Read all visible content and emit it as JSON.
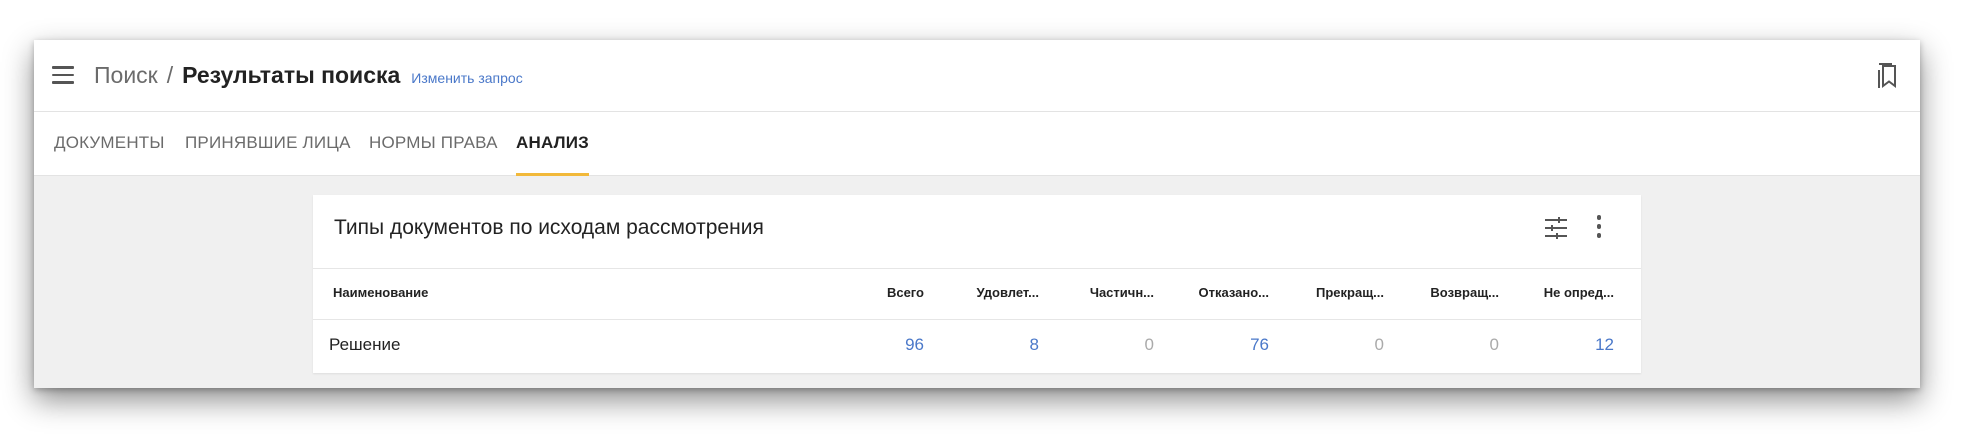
{
  "header": {
    "breadcrumb_root": "Поиск",
    "breadcrumb_separator": "/",
    "breadcrumb_current": "Результаты поиска",
    "edit_query_link": "Изменить запрос"
  },
  "tabs": [
    {
      "label": "ДОКУМЕНТЫ",
      "active": false
    },
    {
      "label": "ПРИНЯВШИЕ ЛИЦА",
      "active": false
    },
    {
      "label": "НОРМЫ ПРАВА",
      "active": false
    },
    {
      "label": "АНАЛИЗ",
      "active": true
    }
  ],
  "card": {
    "title": "Типы документов по исходам рассмотрения",
    "columns": [
      "Наименование",
      "Всего",
      "Удовлет...",
      "Частичн...",
      "Отказано...",
      "Прекращ...",
      "Возвращ...",
      "Не опред..."
    ],
    "rows": [
      {
        "name": "Решение",
        "values": [
          "96",
          "8",
          "0",
          "76",
          "0",
          "0",
          "12"
        ]
      }
    ]
  },
  "colors": {
    "accent_tab": "#f2b93a",
    "link": "#4a78c9",
    "zero_value": "#aaaaaa"
  },
  "icons": [
    "menu-icon",
    "bookmark-icon",
    "tune-icon",
    "more-vert-icon"
  ]
}
